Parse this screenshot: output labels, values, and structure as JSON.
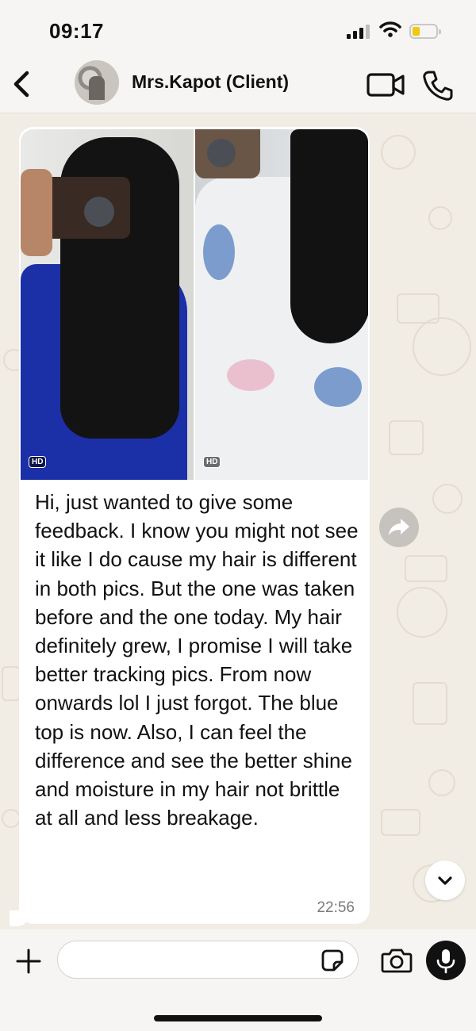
{
  "status_bar": {
    "time": "09:17",
    "signal_icon": "cellular-signal-icon",
    "wifi_icon": "wifi-icon",
    "battery_icon": "battery-low-icon",
    "battery_level": 0.25
  },
  "header": {
    "back_icon": "chevron-left-icon",
    "contact_name": "Mrs.Kapot (Client)",
    "video_call_icon": "video-camera-icon",
    "voice_call_icon": "phone-icon"
  },
  "message": {
    "photo_badges": [
      "HD",
      "HD"
    ],
    "text": "Hi, just wanted to give some feedback. I know you might not see it like I do cause my hair is different in both pics. But the one was taken before and the one today. My hair definitely grew, I promise I will take better tracking pics. From now onwards lol I just forgot. The blue top is now. Also, I can feel the difference and see the better shine and moisture in my hair not brittle at all and less breakage.",
    "time": "22:56",
    "forward_icon": "forward-arrow-icon"
  },
  "scroll_down_icon": "chevron-down-icon",
  "input_bar": {
    "attach_icon": "plus-icon",
    "sticker_icon": "sticker-icon",
    "camera_icon": "camera-icon",
    "mic_icon": "microphone-icon"
  },
  "colors": {
    "chat_background": "#f1ece4",
    "bubble": "#ffffff",
    "bar_background": "#f6f5f3",
    "battery_fill": "#f2c80f",
    "timestamp": "#7b7b7b"
  }
}
